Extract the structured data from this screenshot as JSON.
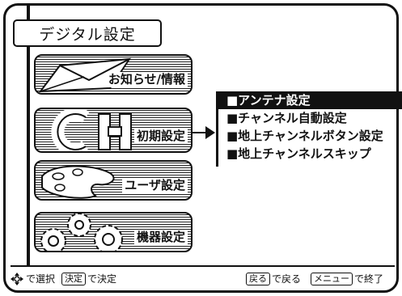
{
  "screen": {
    "title": "デジタル設定"
  },
  "main_menu": [
    {
      "label": "お知らせ/情報",
      "icon": "envelope-icon"
    },
    {
      "label": "初期設定",
      "icon": "ch-icon"
    },
    {
      "label": "ユーザ設定",
      "icon": "palette-icon"
    },
    {
      "label": "機器設定",
      "icon": "gears-icon"
    }
  ],
  "submenu": {
    "items": [
      {
        "label": "■アンテナ設定",
        "selected": true
      },
      {
        "label": "■チャンネル自動設定",
        "selected": false
      },
      {
        "label": "■地上チャンネルボタン設定",
        "selected": false
      },
      {
        "label": "■地上チャンネルスキップ",
        "selected": false
      }
    ]
  },
  "footer": {
    "select_text": "で選択",
    "decide_key": "決定",
    "decide_text": "で決定",
    "back_key": "戻る",
    "back_text": "で戻る",
    "menu_key": "メニュー",
    "menu_text": "で終了"
  }
}
